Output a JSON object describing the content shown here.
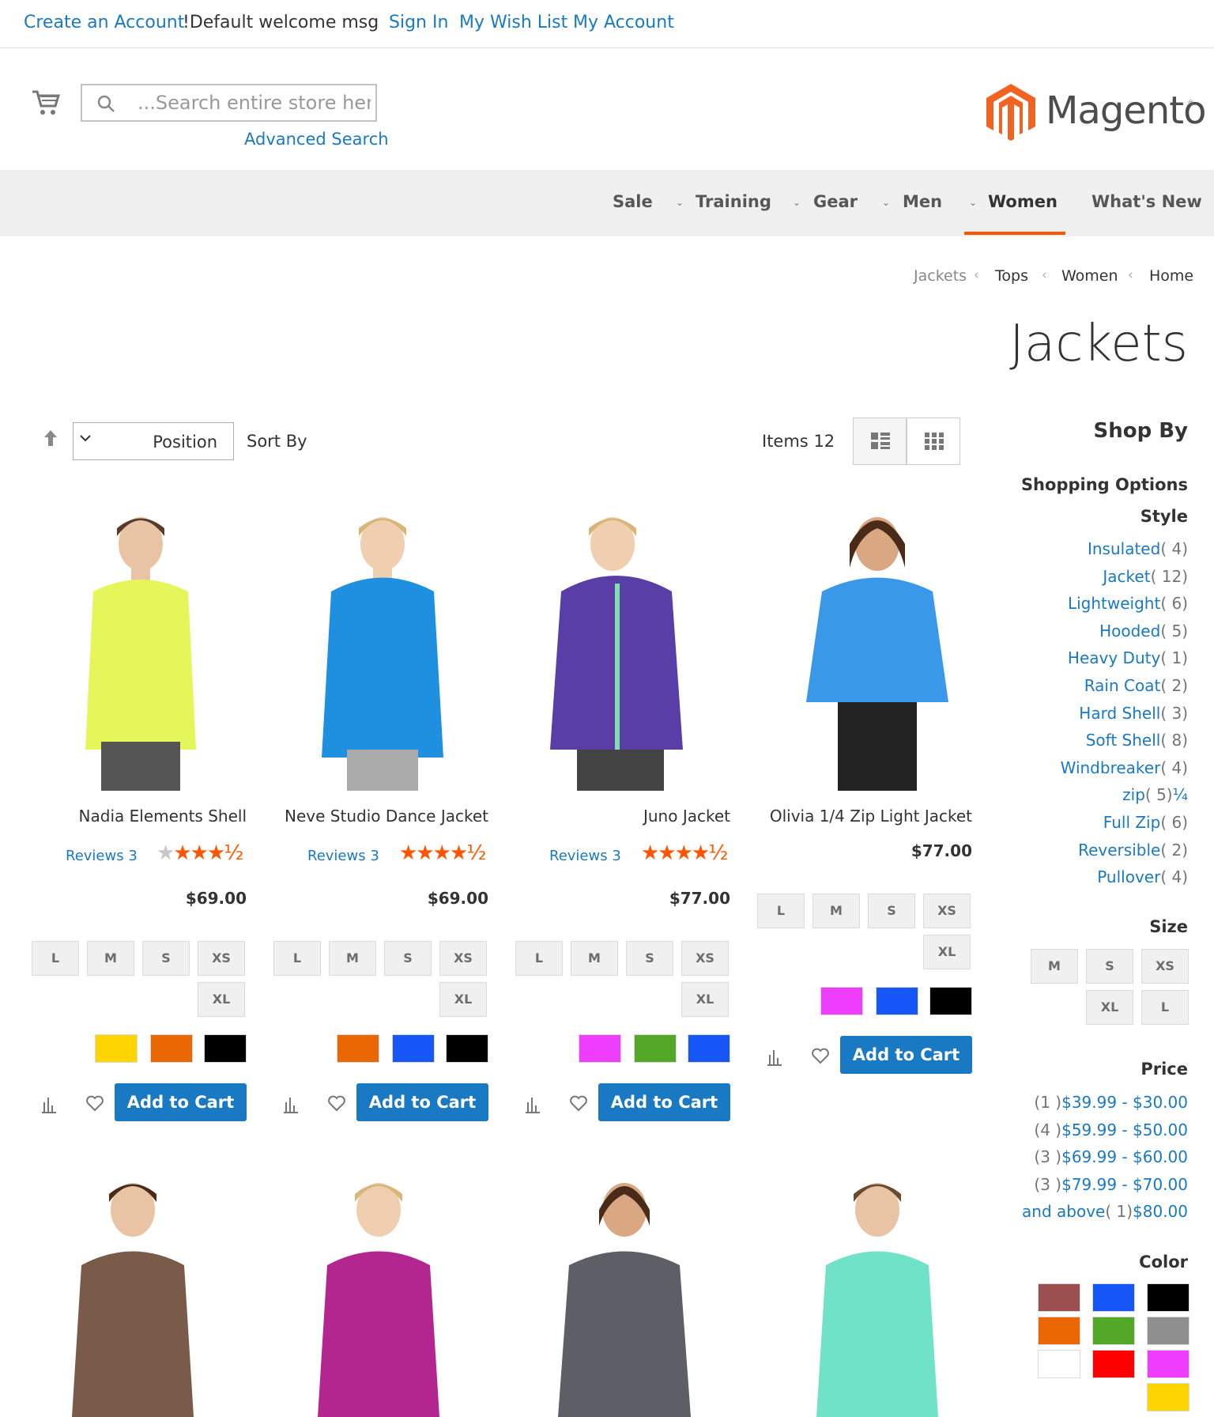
{
  "topbar": {
    "create_account": "Create an Account",
    "welcome": "!Default welcome msg",
    "sign_in": "Sign In",
    "wish_list": "My Wish List",
    "my_account": "My Account"
  },
  "header": {
    "search_placeholder": "...Search entire store here",
    "advanced_search": "Advanced Search",
    "logo_text": "Magento",
    "logo_mark": "®"
  },
  "nav": {
    "sale": "Sale",
    "training": "Training",
    "gear": "Gear",
    "men": "Men",
    "women": "Women",
    "whats_new": "What's New",
    "chevron": "⌄"
  },
  "breadcrumb": [
    "Jackets",
    "Tops",
    "Women",
    "Home"
  ],
  "breadcrumb_sep": "‹",
  "page_title": "Jackets",
  "toolbar": {
    "sort_value": "Position",
    "sort_label": "Sort By",
    "items_label": "Items",
    "items_count": "12"
  },
  "products": [
    {
      "name": "Nadia Elements Shell",
      "reviews_label": "Reviews",
      "reviews_count": "3",
      "price": "$69.00",
      "sizes_row1": [
        "L",
        "M",
        "S",
        "XS"
      ],
      "sizes_row2": [
        "XL"
      ],
      "colors": [
        "#ffd500",
        "#eb6703",
        "#000000"
      ],
      "add_to_cart": "Add to Cart",
      "jacket_color": "#e4f65a"
    },
    {
      "name": "Neve Studio Dance Jacket",
      "reviews_label": "Reviews",
      "reviews_count": "3",
      "price": "$69.00",
      "sizes_row1": [
        "L",
        "M",
        "S",
        "XS"
      ],
      "sizes_row2": [
        "XL"
      ],
      "colors": [
        "#eb6703",
        "#1857f7",
        "#000000"
      ],
      "add_to_cart": "Add to Cart",
      "jacket_color": "#1f8fe0"
    },
    {
      "name": "Juno Jacket",
      "reviews_label": "Reviews",
      "reviews_count": "3",
      "price": "$77.00",
      "sizes_row1": [
        "L",
        "M",
        "S",
        "XS"
      ],
      "sizes_row2": [
        "XL"
      ],
      "colors": [
        "#ef3dff",
        "#53a828",
        "#1857f7"
      ],
      "add_to_cart": "Add to Cart",
      "jacket_color": "#5a3ea8"
    },
    {
      "name": "Olivia 1/4 Zip Light Jacket",
      "price": "$77.00",
      "sizes_row1": [
        "L",
        "M",
        "S",
        "XS"
      ],
      "sizes_row2": [
        "XL"
      ],
      "colors": [
        "#ef3dff",
        "#1857f7",
        "#000000"
      ],
      "add_to_cart": "Add to Cart",
      "jacket_color": "#3a98e8"
    }
  ],
  "products_row2_colors": [
    "#7a5a48",
    "#b3258f",
    "#5e5e66",
    "#6fe2c8"
  ],
  "sidebar": {
    "shop_by": "Shop By",
    "shopping_options": "Shopping Options",
    "style_title": "Style",
    "style": [
      {
        "label": "Insulated",
        "count": "( 4)"
      },
      {
        "label": "Jacket",
        "count": "( 12)"
      },
      {
        "label": "Lightweight",
        "count": "( 6)"
      },
      {
        "label": "Hooded",
        "count": "( 5)"
      },
      {
        "label": "Heavy Duty",
        "count": "( 1)"
      },
      {
        "label": "Rain Coat",
        "count": "( 2)"
      },
      {
        "label": "Hard Shell",
        "count": "( 3)"
      },
      {
        "label": "Soft Shell",
        "count": "( 8)"
      },
      {
        "label": "Windbreaker",
        "count": "( 4)"
      },
      {
        "label": "zip",
        "count": "( 5)",
        "suffix": "¼"
      },
      {
        "label": "Full Zip",
        "count": "( 6)"
      },
      {
        "label": "Reversible",
        "count": "( 2)"
      },
      {
        "label": "Pullover",
        "count": "( 4)"
      }
    ],
    "size_title": "Size",
    "sizes_row1": [
      "M",
      "S",
      "XS"
    ],
    "sizes_row2": [
      "XL",
      "L"
    ],
    "price_title": "Price",
    "prices": [
      {
        "count": "(1 )",
        "label": "$39.99 - $30.00"
      },
      {
        "count": "(4 )",
        "label": "$59.99 - $50.00"
      },
      {
        "count": "(3 )",
        "label": "$69.99 - $60.00"
      },
      {
        "count": "(3 )",
        "label": "$79.99 - $70.00"
      },
      {
        "label_a": "and above",
        "count": "( 1)",
        "label_b": "$80.00"
      }
    ],
    "color_title": "Color",
    "colors": [
      "#9b4f4f",
      "#1857f7",
      "#000000",
      "#eb6703",
      "#53a828",
      "#8f8f8f",
      "#ffffff",
      "#ff0000",
      "#ef3dff",
      "#ffd500"
    ]
  }
}
